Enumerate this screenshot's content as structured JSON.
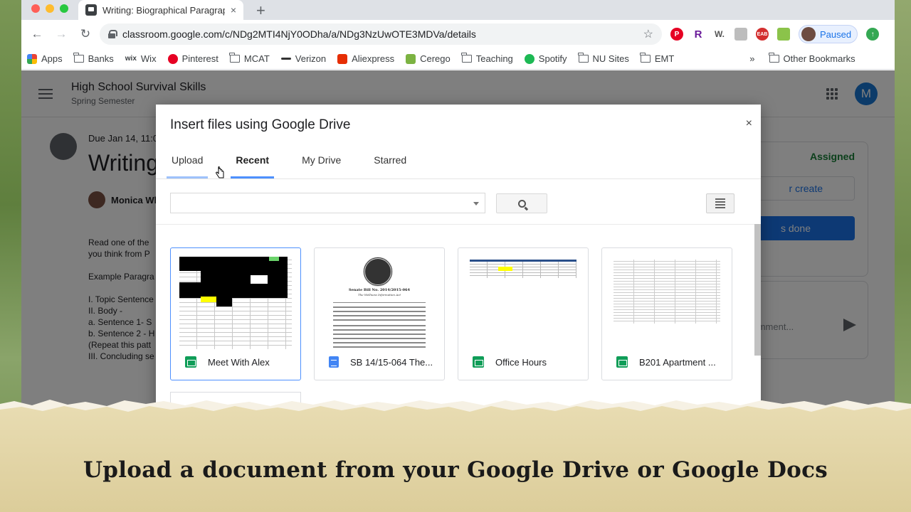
{
  "browser": {
    "tab_title": "Writing: Biographical Paragrap",
    "tab_close": "×",
    "new_tab": "+",
    "url": "classroom.google.com/c/NDg2MTI4NjY0ODha/a/NDg3NzUwOTE3MDVa/details",
    "profile_status": "Paused",
    "extensions": [
      "R",
      "W.",
      "EAB"
    ],
    "bookmarks": [
      {
        "label": "Apps",
        "icon": "apps-grid-icon"
      },
      {
        "label": "Banks",
        "icon": "folder-icon"
      },
      {
        "label": "Wix",
        "icon": "wix-icon"
      },
      {
        "label": "Pinterest",
        "icon": "pinterest-icon"
      },
      {
        "label": "MCAT",
        "icon": "folder-icon"
      },
      {
        "label": "Verizon",
        "icon": "verizon-icon"
      },
      {
        "label": "Aliexpress",
        "icon": "aliexpress-icon"
      },
      {
        "label": "Cerego",
        "icon": "cerego-icon"
      },
      {
        "label": "Teaching",
        "icon": "folder-icon"
      },
      {
        "label": "Spotify",
        "icon": "spotify-icon"
      },
      {
        "label": "NU Sites",
        "icon": "folder-icon"
      },
      {
        "label": "EMT",
        "icon": "folder-icon"
      }
    ],
    "bookmarks_overflow": "»",
    "other_bookmarks": "Other Bookmarks"
  },
  "classroom": {
    "class_name": "High School Survival Skills",
    "section": "Spring Semester",
    "avatar_letter": "M",
    "due": "Due Jan 14, 11:0",
    "title": "Writing",
    "author": "Monica Wh",
    "description": [
      "Read one of the",
      "you think from P",
      "",
      "Example Paragra",
      "",
      "I. Topic Sentence",
      "II. Body -",
      "a. Sentence 1- S",
      "b. Sentence 2 - H",
      "(Repeat this patt",
      "III. Concluding se"
    ],
    "status": "Assigned",
    "create_label": "r create",
    "done_label": "s done",
    "comment_placeholder": "comment..."
  },
  "dialog": {
    "title": "Insert files using Google Drive",
    "close": "×",
    "tabs": [
      "Upload",
      "Recent",
      "My Drive",
      "Starred"
    ],
    "active_tab": "Recent",
    "files": [
      {
        "name": "Meet With Alex",
        "type": "sheets",
        "selected": true
      },
      {
        "name": "SB 14/15-064 The...",
        "type": "docs",
        "selected": false
      },
      {
        "name": "Office Hours",
        "type": "sheets",
        "selected": false
      },
      {
        "name": "B201 Apartment ...",
        "type": "sheets",
        "selected": false
      }
    ],
    "doc_thumb_title": "Senate Bill No. 2014/2015-064",
    "doc_thumb_subtitle": "The Wellness Information Act"
  },
  "caption": "Upload a document from your Google Drive or Google Docs",
  "colors": {
    "accent": "#4d90fe",
    "assigned_green": "#188038",
    "sheets_green": "#0f9d58",
    "docs_blue": "#4285f4"
  }
}
